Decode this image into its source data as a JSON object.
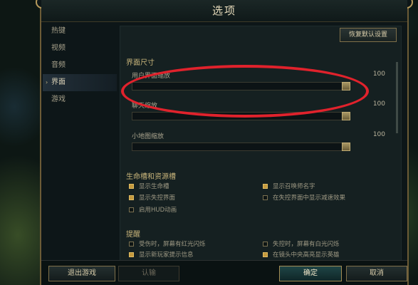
{
  "window": {
    "title": "选项"
  },
  "sidebar": {
    "items": [
      {
        "label": "热键",
        "active": false
      },
      {
        "label": "视频",
        "active": false
      },
      {
        "label": "音频",
        "active": false
      },
      {
        "label": "界面",
        "active": true
      },
      {
        "label": "游戏",
        "active": false
      }
    ]
  },
  "main": {
    "reset_label": "恢复默认设置",
    "section_ui_size": "界面尺寸",
    "sliders": [
      {
        "label": "用户界面缩放",
        "value": "100",
        "fraction": 1.0
      },
      {
        "label": "聊天缩放",
        "value": "100",
        "fraction": 1.0
      },
      {
        "label": "小地图缩放",
        "value": "100",
        "fraction": 1.0
      }
    ],
    "section_health": "生命槽和资源槽",
    "health_opts": [
      {
        "label": "显示生命槽",
        "checked": true
      },
      {
        "label": "显示召唤师名字",
        "checked": true
      },
      {
        "label": "显示失控界面",
        "checked": true
      },
      {
        "label": "在失控界面中显示减速效果",
        "checked": false
      },
      {
        "label": "启用HUD动画",
        "checked": false
      }
    ],
    "section_alert": "提醒",
    "alert_opts": [
      {
        "label": "受伤时，屏幕有红光闪烁",
        "checked": false
      },
      {
        "label": "失控时，屏幕有白光闪烁",
        "checked": false
      },
      {
        "label": "显示新玩家提示信息",
        "checked": true
      },
      {
        "label": "在镜头中央高亮显示英雄",
        "checked": true
      }
    ]
  },
  "footer": {
    "exit_label": "退出游戏",
    "surrender_label": "认输",
    "ok_label": "确定",
    "cancel_label": "取消"
  },
  "colors": {
    "accent_gold": "#c59a3e",
    "highlight_ring": "#e0222c"
  }
}
